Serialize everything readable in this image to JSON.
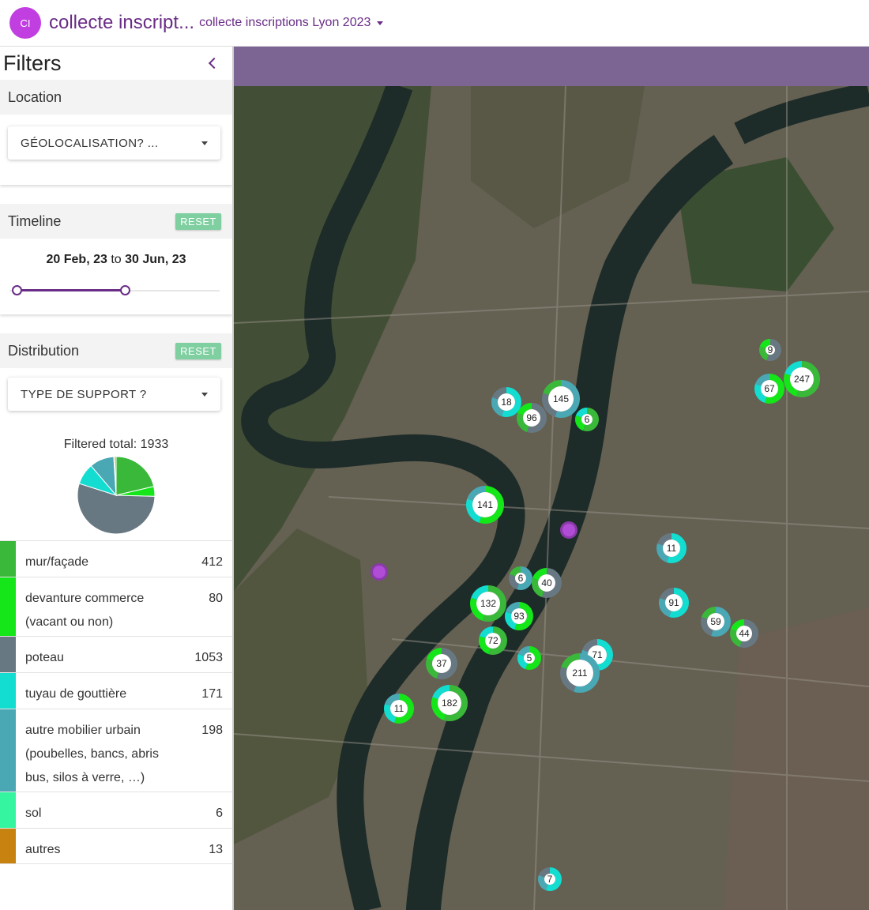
{
  "header": {
    "avatar_initials": "CI",
    "title": "collecte inscript...",
    "subtitle": "collecte inscriptions Lyon 2023"
  },
  "sidebar": {
    "title": "Filters",
    "location": {
      "label": "Location",
      "select_value": "GÉOLOCALISATION? ..."
    },
    "timeline": {
      "label": "Timeline",
      "reset_label": "RESET",
      "from": "20 Feb, 23",
      "to_word": "to",
      "to": "30 Jun, 23"
    },
    "distribution": {
      "label": "Distribution",
      "reset_label": "RESET",
      "select_value": "TYPE DE SUPPORT ?",
      "total_label": "Filtered total: 1933",
      "items": [
        {
          "label": "mur/façade",
          "count": "412",
          "color": "#39b83a"
        },
        {
          "label": "devanture commerce (vacant ou non)",
          "count": "80",
          "color": "#14e61a"
        },
        {
          "label": "poteau",
          "count": "1053",
          "color": "#687882"
        },
        {
          "label": "tuyau de gouttière",
          "count": "171",
          "color": "#12ddd0"
        },
        {
          "label": "autre mobilier urbain (poubelles, bancs, abris bus, silos à verre, …)",
          "count": "198",
          "color": "#4aa7b4"
        },
        {
          "label": "sol",
          "count": "6",
          "color": "#36f5a0"
        },
        {
          "label": "autres",
          "count": "13",
          "color": "#c78210"
        }
      ]
    }
  },
  "map": {
    "band_color": "#7c6593",
    "clusters": [
      {
        "count": "9"
      },
      {
        "count": "247"
      },
      {
        "count": "67"
      },
      {
        "count": "18"
      },
      {
        "count": "145"
      },
      {
        "count": "96"
      },
      {
        "count": "6"
      },
      {
        "count": "141"
      },
      {
        "count": "11"
      },
      {
        "count": "6"
      },
      {
        "count": "40"
      },
      {
        "count": "132"
      },
      {
        "count": "93"
      },
      {
        "count": "91"
      },
      {
        "count": "59"
      },
      {
        "count": "44"
      },
      {
        "count": "72"
      },
      {
        "count": "5"
      },
      {
        "count": "71"
      },
      {
        "count": "211"
      },
      {
        "count": "37"
      },
      {
        "count": "182"
      },
      {
        "count": "11"
      },
      {
        "count": "7"
      }
    ]
  }
}
